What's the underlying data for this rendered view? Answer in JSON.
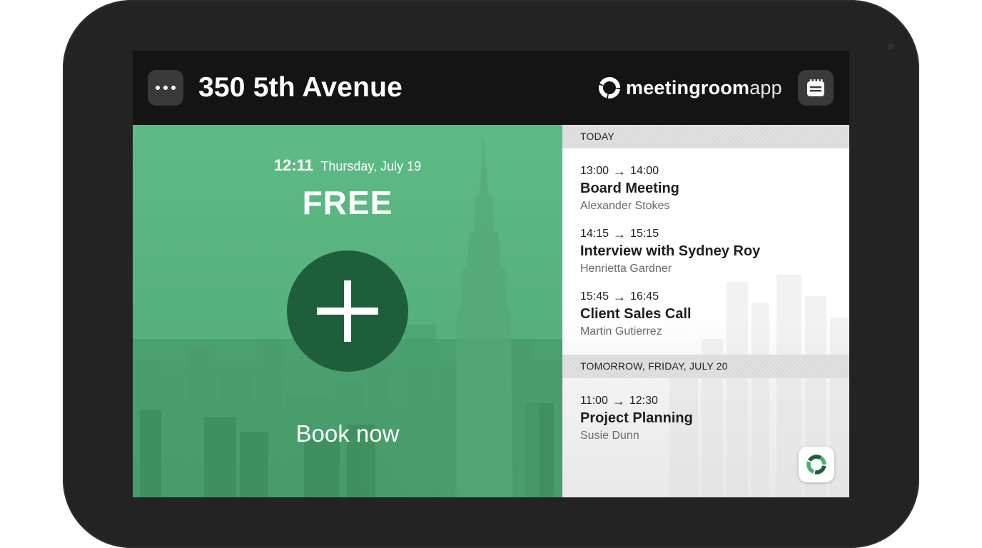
{
  "header": {
    "room_name": "350 5th Avenue",
    "brand_bold": "meetingroom",
    "brand_light": "app",
    "menu_icon": "ellipsis-icon",
    "calendar_icon": "calendar-icon"
  },
  "status_panel": {
    "clock": "12:11",
    "date": "Thursday, July 19",
    "status": "FREE",
    "book_label": "Book now",
    "accent_color": "#5fbb86",
    "button_color": "#1f5e3a"
  },
  "schedule": {
    "days": [
      {
        "header": "TODAY",
        "events": [
          {
            "start": "13:00",
            "end": "14:00",
            "title": "Board Meeting",
            "organizer": "Alexander Stokes"
          },
          {
            "start": "14:15",
            "end": "15:15",
            "title": "Interview with Sydney Roy",
            "organizer": "Henrietta Gardner"
          },
          {
            "start": "15:45",
            "end": "16:45",
            "title": "Client Sales Call",
            "organizer": "Martin Gutierrez"
          }
        ]
      },
      {
        "header": "TOMORROW, FRIDAY, JULY 20",
        "events": [
          {
            "start": "11:00",
            "end": "12:30",
            "title": "Project Planning",
            "organizer": "Susie Dunn"
          }
        ]
      }
    ],
    "arrow_glyph": "→"
  }
}
